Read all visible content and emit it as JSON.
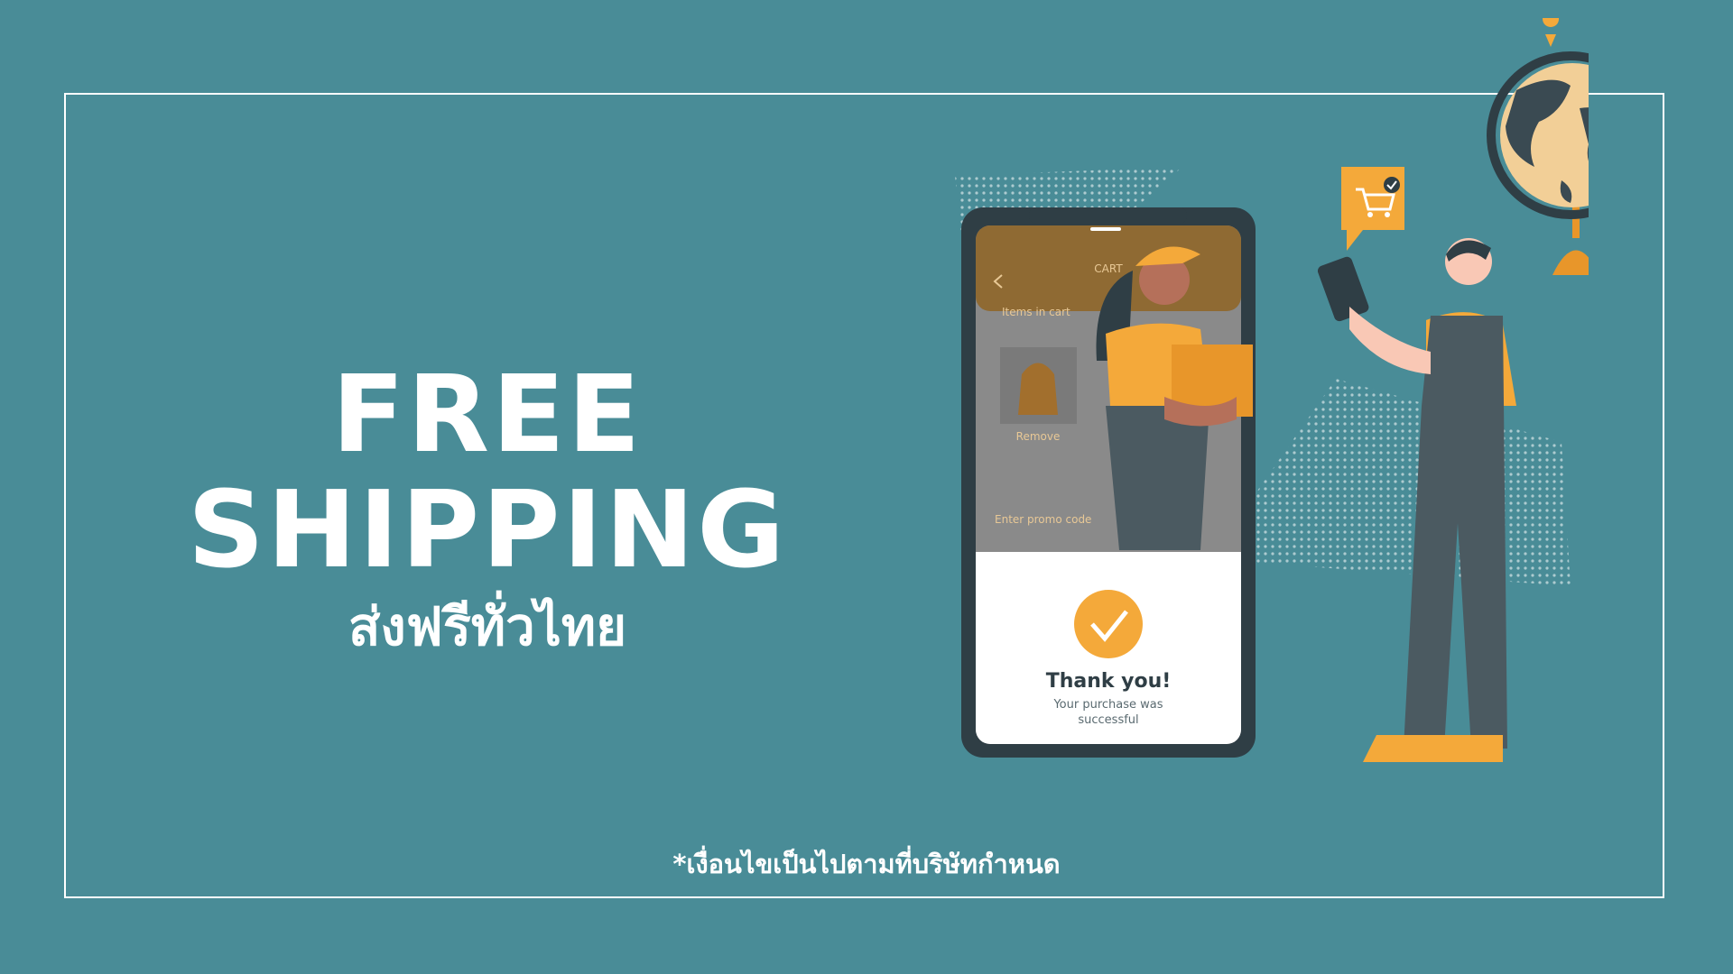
{
  "headline": {
    "line1": "FREE",
    "line2": "SHIPPING",
    "thai": "ส่งฟรีทั่วไทย"
  },
  "footnote": "*เงื่อนไขเป็นไปตามที่บริษัทกำหนด",
  "phone": {
    "header_title": "CART",
    "items_label": "Items in cart",
    "remove_label": "Remove",
    "promo_label": "Enter promo code",
    "thank_you": "Thank you!",
    "success_line1": "Your purchase was",
    "success_line2": "successful"
  },
  "colors": {
    "background": "#498c97",
    "accent_yellow": "#f4a93a",
    "phone_body": "#2f3e45",
    "phone_header": "#8f6a33"
  },
  "icons": [
    "globe-icon",
    "cart-check-icon",
    "checkmark-icon",
    "back-chevron-icon",
    "backpack-icon",
    "location-pin-icon"
  ]
}
